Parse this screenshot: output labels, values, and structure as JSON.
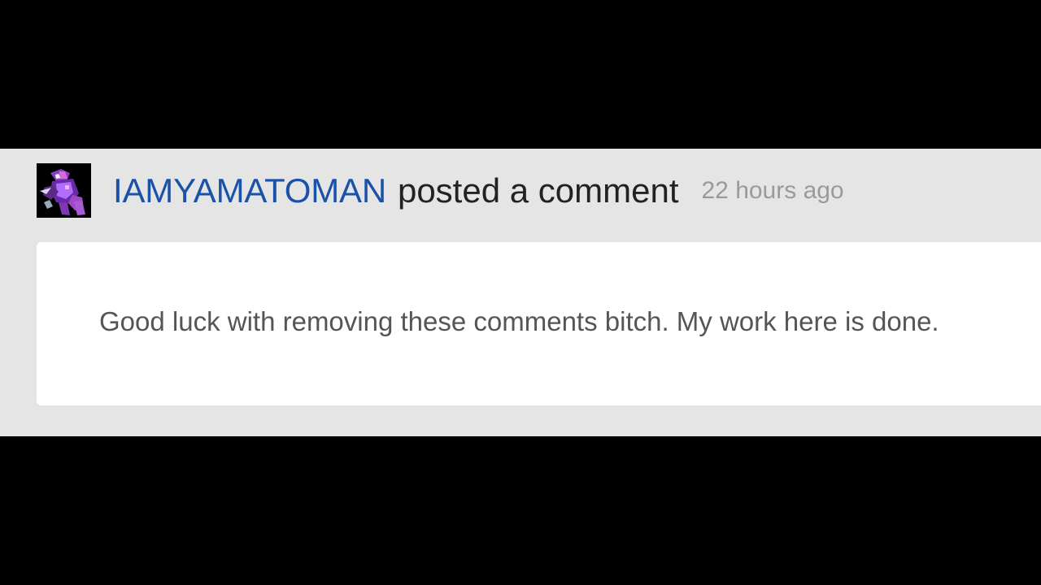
{
  "comment": {
    "avatar_icon": "purple-armored-robot-avatar",
    "username": "IAMYAMATOMAN",
    "action": "posted a comment",
    "timestamp": "22 hours ago",
    "text": "Good luck with removing these comments bitch. My work here is done."
  },
  "colors": {
    "background": "#000000",
    "card": "#e5e5e5",
    "body": "#ffffff",
    "username": "#1a52a8",
    "action": "#222222",
    "timestamp": "#9a9a9a",
    "comment_text": "#555555"
  }
}
